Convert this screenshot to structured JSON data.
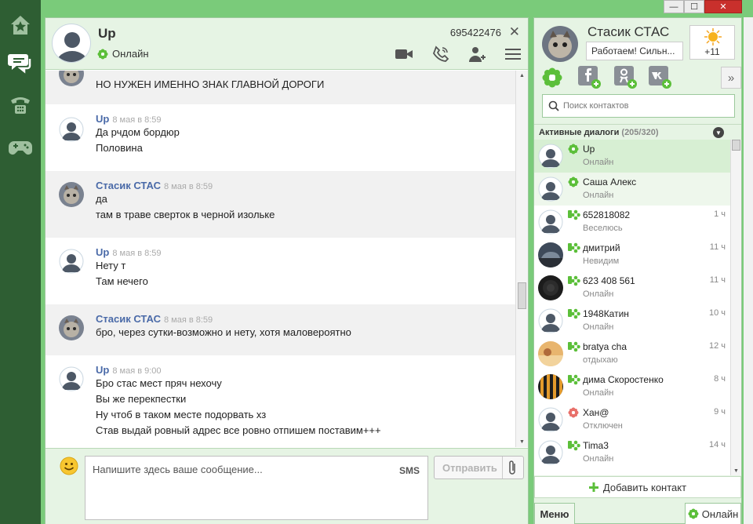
{
  "colors": {
    "accent": "#7acb7a",
    "rail": "#2e5e33",
    "link": "#4a6aa8",
    "offline": "#e8706a"
  },
  "chat": {
    "name": "Up",
    "status": "Онлайн",
    "uin": "695422476",
    "close": "✕"
  },
  "messages": [
    {
      "author": "",
      "time": "",
      "lines": [
        "НО НУЖЕН ИМЕННО ЗНАК ГЛАВНОЙ ДОРОГИ"
      ],
      "who": "st"
    },
    {
      "author": "Up",
      "time": "8 мая в 8:59",
      "lines": [
        "Да рчдом бордюр",
        "Половина"
      ],
      "who": "up"
    },
    {
      "author": "Стасик СТАС",
      "time": "8 мая в 8:59",
      "lines": [
        "да",
        "там в траве сверток в черной изольке"
      ],
      "who": "st"
    },
    {
      "author": "Up",
      "time": "8 мая в 8:59",
      "lines": [
        "Нету т",
        "Там нечего"
      ],
      "who": "up"
    },
    {
      "author": "Стасик СТАС",
      "time": "8 мая в 8:59",
      "lines": [
        "бро, через сутки-возможно и нету, хотя маловероятно"
      ],
      "who": "st"
    },
    {
      "author": "Up",
      "time": "8 мая в 9:00",
      "lines": [
        "Бро стас мест пряч нехочу",
        "Вы же перекпестки",
        "Ну чтоб в таком месте подорвать хз",
        "Став выдай ровный адрес все ровно отпишем поставим+++"
      ],
      "who": "up"
    }
  ],
  "composer": {
    "placeholder": "Напишите здесь ваше сообщение...",
    "sms": "SMS",
    "send": "Отправить"
  },
  "me": {
    "name": "Стасик СТАС",
    "status": "Работаем! Сильн...",
    "temp": "+11"
  },
  "search": {
    "placeholder": "Поиск контактов"
  },
  "list": {
    "title": "Активные диалоги",
    "count": "(205/320)"
  },
  "contacts": [
    {
      "name": "Up",
      "status": "Онлайн",
      "time": "",
      "state": "online",
      "avatar": "default",
      "row": "active"
    },
    {
      "name": "Саша Алекс",
      "status": "Онлайн",
      "time": "",
      "state": "online",
      "avatar": "default",
      "row": "hover"
    },
    {
      "name": "652818082",
      "status": "Веселюсь",
      "time": "1 ч",
      "state": "mobile",
      "avatar": "default",
      "row": ""
    },
    {
      "name": "дмитрий",
      "status": "Невидим",
      "time": "11 ч",
      "state": "mobile",
      "avatar": "car",
      "row": ""
    },
    {
      "name": "623 408 561",
      "status": "Онлайн",
      "time": "11 ч",
      "state": "mobile",
      "avatar": "dark",
      "row": ""
    },
    {
      "name": "1948Катин",
      "status": "Онлайн",
      "time": "10 ч",
      "state": "mobile",
      "avatar": "default",
      "row": ""
    },
    {
      "name": "bratya cha",
      "status": "отдыхаю",
      "time": "12 ч",
      "state": "mobile",
      "avatar": "beach",
      "row": ""
    },
    {
      "name": "дима Скоростенко",
      "status": "Онлайн",
      "time": "8 ч",
      "state": "mobile",
      "avatar": "stripe",
      "row": ""
    },
    {
      "name": "Хан@",
      "status": "Отключен",
      "time": "9 ч",
      "state": "offline",
      "avatar": "default",
      "row": ""
    },
    {
      "name": "Tima3",
      "status": "Онлайн",
      "time": "14 ч",
      "state": "mobile",
      "avatar": "default",
      "row": ""
    }
  ],
  "footer": {
    "add_contact": "Добавить контакт",
    "menu": "Меню",
    "status": "Онлайн"
  },
  "window": {
    "minimize": "—",
    "maximize": "☐",
    "close": "✕"
  }
}
